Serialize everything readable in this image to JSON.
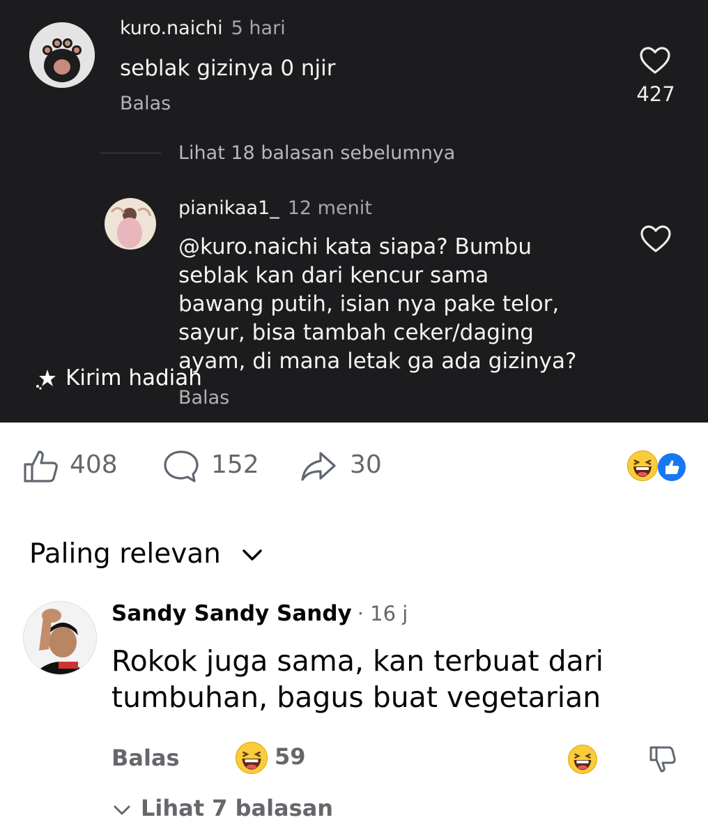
{
  "threads_section": {
    "comment1": {
      "username": "kuro.naichi",
      "time": "5 hari",
      "text": "seblak gizinya 0 njir",
      "reply_label": "Balas",
      "like_count": "427"
    },
    "view_replies": "Lihat 18 balasan sebelumnya",
    "comment2": {
      "username": "pianikaa1_",
      "time": "12 menit",
      "text_lines": [
        "@kuro.naichi kata siapa? Bumbu",
        "seblak kan dari kencur sama",
        "bawang putih, isian nya pake telor,",
        "sayur, bisa tambah ceker/daging",
        "ayam, di mana letak ga ada gizinya?"
      ],
      "reply_label": "Balas"
    },
    "gift_button": "Kirim hadiah"
  },
  "action_bar": {
    "likes": "408",
    "comments": "152",
    "shares": "30"
  },
  "sort_label": "Paling relevan",
  "comment": {
    "author": "Sandy Sandy Sandy",
    "time": "· 16 j",
    "text_lines": [
      "Rokok juga sama, kan terbuat dari",
      "tumbuhan, bagus buat vegetarian"
    ],
    "reply_label": "Balas",
    "reaction_count": "59",
    "view_replies": "Lihat 7 balasan"
  },
  "colors": {
    "dark_bg": "#1c1c1e",
    "fb_blue": "#1877f2",
    "emoji_yellow": "#f9cd3a"
  },
  "icons": [
    "heart-icon",
    "gift-icon",
    "thumbs-up-icon",
    "comment-bubble-icon",
    "share-arrow-icon",
    "haha-emoji-icon",
    "like-reaction-icon",
    "chevron-down-icon",
    "dislike-icon"
  ]
}
